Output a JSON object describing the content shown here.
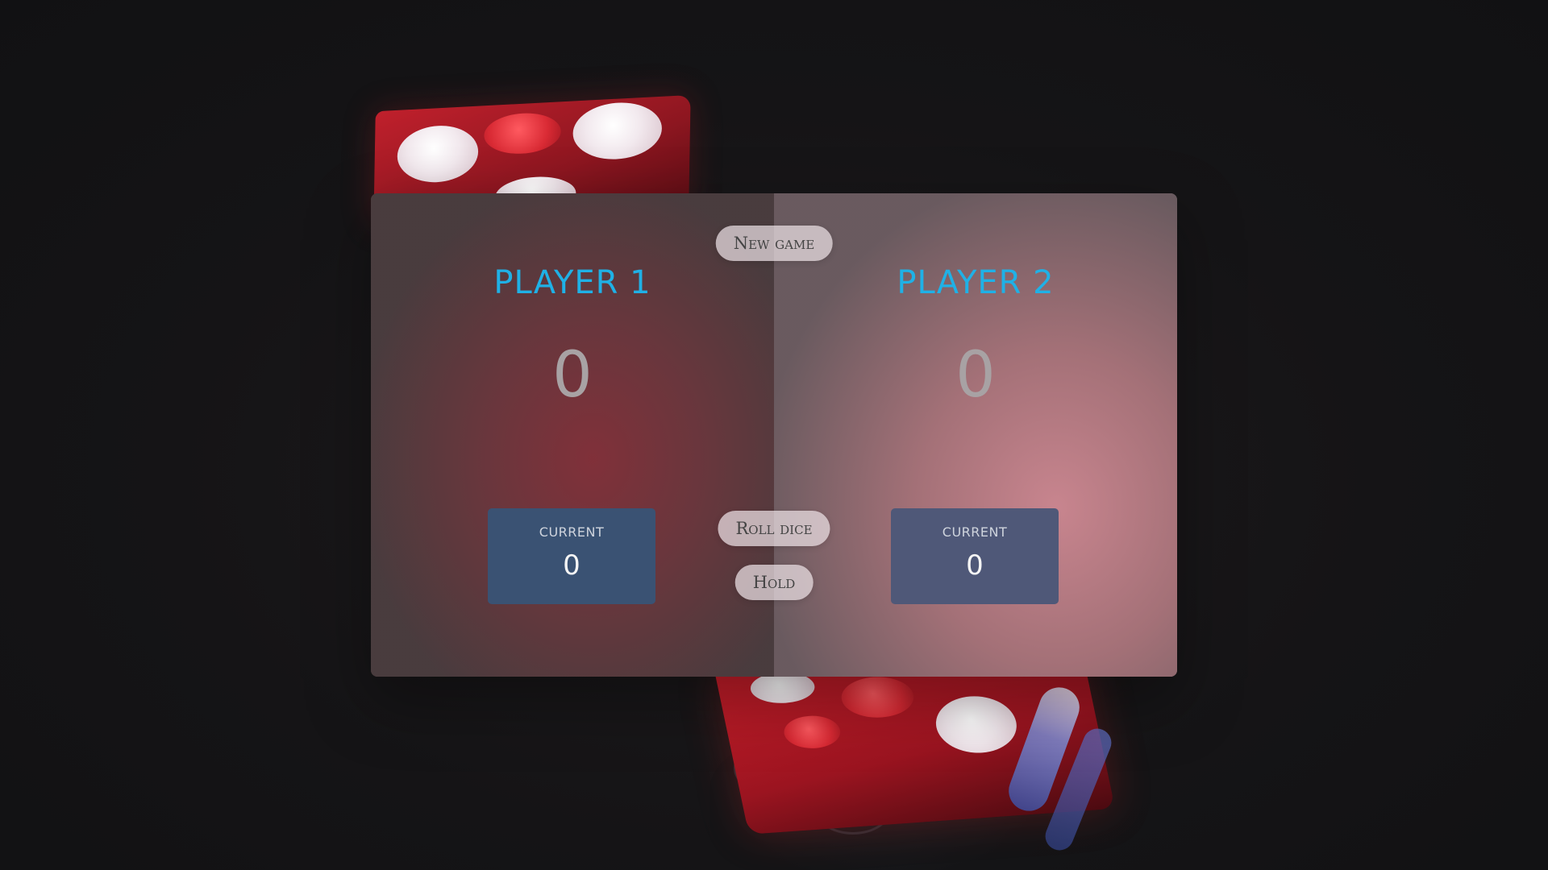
{
  "buttons": {
    "new_game": "New game",
    "roll_dice": "Roll dice",
    "hold": "Hold"
  },
  "players": [
    {
      "name": "PLAYER 1",
      "score": "0",
      "current_label": "CURRENT",
      "current_score": "0"
    },
    {
      "name": "PLAYER 2",
      "score": "0",
      "current_label": "CURRENT",
      "current_score": "0"
    }
  ],
  "colors": {
    "player_name": "#1fb1e6",
    "background": "#141416",
    "die": "#c0202c",
    "current_box_p1": "#3a5273",
    "current_box_p2": "#4f5878"
  },
  "background_image": {
    "icon": "red-dice-photo"
  }
}
